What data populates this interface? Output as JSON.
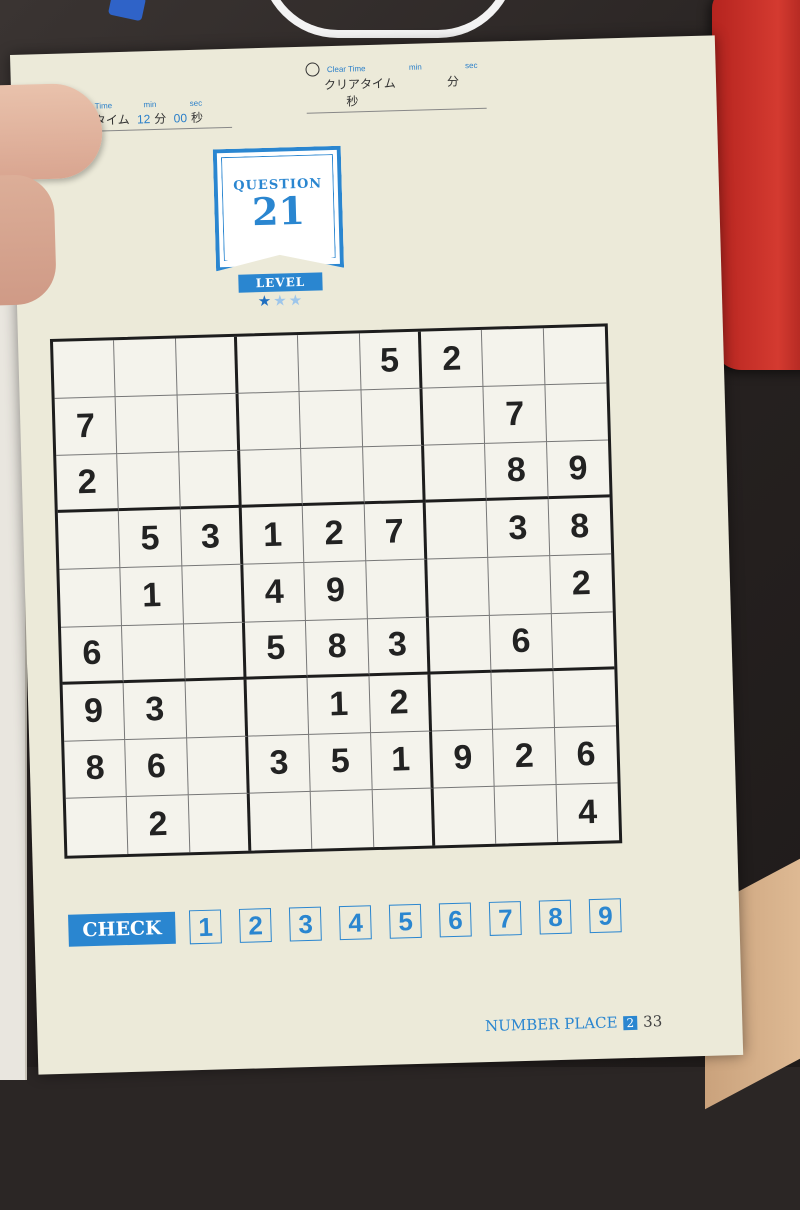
{
  "header": {
    "target_time": {
      "label_en": "get Time",
      "label_jp": "標タイム",
      "min_unit_en": "min",
      "min_value": "12",
      "min_unit_jp": "分",
      "sec_unit_en": "sec",
      "sec_value": "00",
      "sec_unit_jp": "秒"
    },
    "clear_time": {
      "label_en": "Clear Time",
      "label_jp": "クリアタイム",
      "min_unit_en": "min",
      "min_unit_jp": "分",
      "sec_unit_en": "sec",
      "sec_unit_jp": "秒"
    }
  },
  "badge": {
    "question_label": "QUESTION",
    "question_number": "21",
    "level_label": "LEVEL",
    "level_stars_filled": 1,
    "level_stars_total": 3
  },
  "grid": [
    [
      "",
      "",
      "",
      "",
      "",
      "5",
      "2",
      "",
      ""
    ],
    [
      "7",
      "",
      "",
      "",
      "",
      "",
      "",
      "7",
      ""
    ],
    [
      "2",
      "",
      "",
      "",
      "",
      "",
      "",
      "8",
      "9"
    ],
    [
      "",
      "5",
      "3",
      "1",
      "2",
      "7",
      "",
      "3",
      "8"
    ],
    [
      "",
      "1",
      "",
      "4",
      "9",
      "",
      "",
      "",
      "2"
    ],
    [
      "6",
      "",
      "",
      "5",
      "8",
      "3",
      "",
      "6",
      ""
    ],
    [
      "9",
      "3",
      "",
      "",
      "1",
      "2",
      "",
      "",
      ""
    ],
    [
      "8",
      "6",
      "",
      "3",
      "5",
      "1",
      "9",
      "2",
      "6"
    ],
    [
      "",
      "2",
      "",
      "",
      "",
      "",
      "",
      "",
      "4"
    ]
  ],
  "check": {
    "label": "CHECK",
    "numbers": [
      "1",
      "2",
      "3",
      "4",
      "5",
      "6",
      "7",
      "8",
      "9"
    ]
  },
  "footer": {
    "title": "NUMBER PLACE",
    "volume": "2",
    "page_number": "33"
  },
  "colors": {
    "accent": "#2a86d0",
    "paper": "#ecead9",
    "ink": "#1d1d1d"
  }
}
